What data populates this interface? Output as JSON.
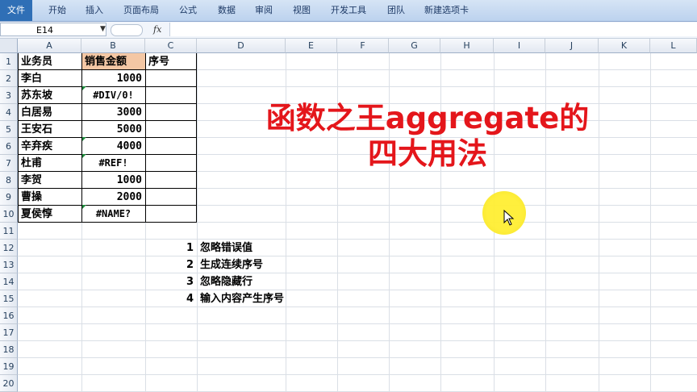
{
  "ribbon": {
    "tabs": [
      "文件",
      "开始",
      "插入",
      "页面布局",
      "公式",
      "数据",
      "审阅",
      "视图",
      "开发工具",
      "团队",
      "新建选项卡"
    ]
  },
  "formula_bar": {
    "name_box": "E14",
    "fx": "fx",
    "formula": ""
  },
  "columns": [
    "A",
    "B",
    "C",
    "D",
    "E",
    "F",
    "G",
    "H",
    "I",
    "J",
    "K",
    "L"
  ],
  "rows": [
    "1",
    "2",
    "3",
    "4",
    "5",
    "6",
    "7",
    "8",
    "9",
    "10",
    "11",
    "12",
    "13",
    "14",
    "15",
    "16",
    "17",
    "18",
    "19",
    "20"
  ],
  "table": {
    "headers": [
      "业务员",
      "销售金额",
      "序号"
    ],
    "rows": [
      {
        "name": "李白",
        "amount": "1000"
      },
      {
        "name": "苏东坡",
        "amount": "#DIV/0!"
      },
      {
        "name": "白居易",
        "amount": "3000"
      },
      {
        "name": "王安石",
        "amount": "5000"
      },
      {
        "name": "辛弃疾",
        "amount": "4000"
      },
      {
        "name": "杜甫",
        "amount": "#REF!"
      },
      {
        "name": "李贺",
        "amount": "1000"
      },
      {
        "name": "曹操",
        "amount": "2000"
      },
      {
        "name": "夏侯惇",
        "amount": "#NAME?"
      }
    ]
  },
  "notes": [
    {
      "num": "1",
      "text": "忽略错误值"
    },
    {
      "num": "2",
      "text": "生成连续序号"
    },
    {
      "num": "3",
      "text": "忽略隐藏行"
    },
    {
      "num": "4",
      "text": "输入内容产生序号"
    }
  ],
  "overlay": {
    "line1": "函数之王aggregate的",
    "line2": "四大用法",
    "color": "#e4161b"
  },
  "colors": {
    "header_fill": "#f4c7a4",
    "ribbon": "#bcd2ee"
  }
}
